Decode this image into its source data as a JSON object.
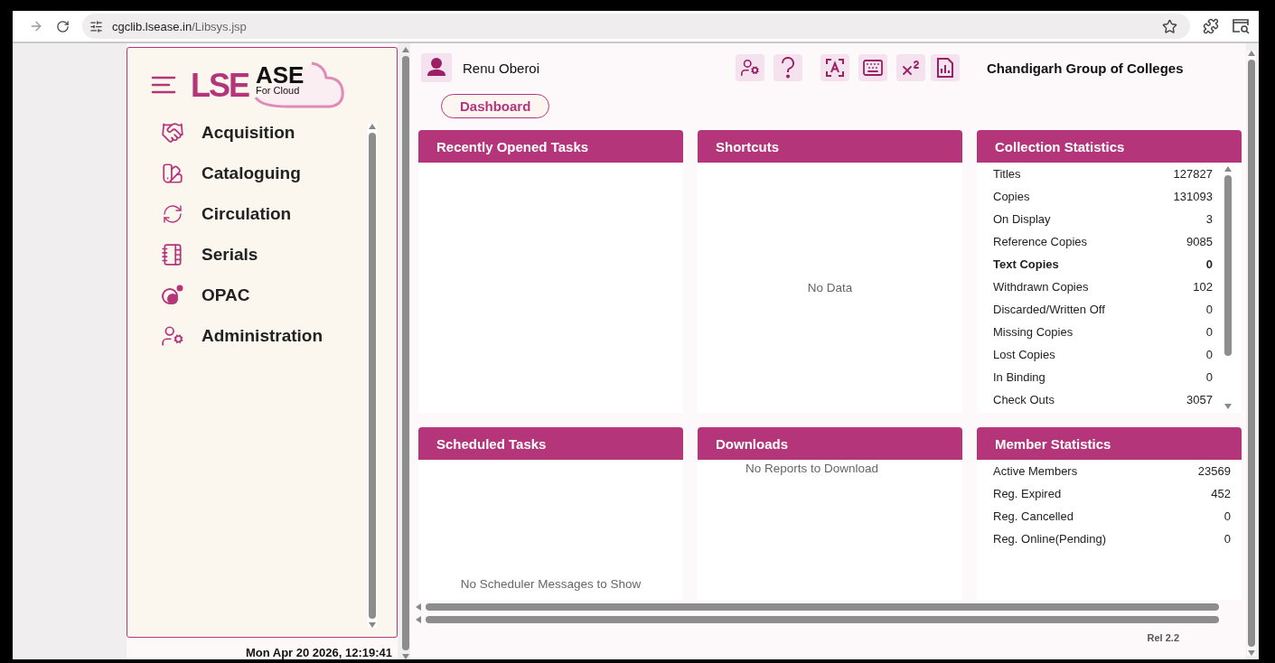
{
  "browser": {
    "url_host": "cgclib.lsease.in",
    "url_path": "/Libsys.jsp"
  },
  "logo": {
    "mark": "LSE",
    "accent": "ASE",
    "tagline": "For Cloud"
  },
  "sidebar": {
    "items": [
      {
        "label": "Acquisition"
      },
      {
        "label": "Cataloguing"
      },
      {
        "label": "Circulation"
      },
      {
        "label": "Serials"
      },
      {
        "label": "OPAC"
      },
      {
        "label": "Administration"
      }
    ],
    "datetime": "Mon Apr 20 2026, 12:19:41"
  },
  "header": {
    "user": "Renu Oberoi",
    "organization": "Chandigarh Group of Colleges"
  },
  "tabs": [
    {
      "label": "Dashboard",
      "selected": true
    }
  ],
  "panels": [
    {
      "title": "Recently Opened Tasks",
      "kind": "empty"
    },
    {
      "title": "Shortcuts",
      "kind": "message",
      "message": "No Data"
    },
    {
      "title": "Collection Statistics",
      "kind": "stats",
      "rows": [
        {
          "label": "Titles",
          "value": "127827",
          "bold": false
        },
        {
          "label": "Copies",
          "value": "131093",
          "bold": false
        },
        {
          "label": "On Display",
          "value": "3",
          "bold": false
        },
        {
          "label": "Reference Copies",
          "value": "9085",
          "bold": false
        },
        {
          "label": "Text Copies",
          "value": "0",
          "bold": true
        },
        {
          "label": "Withdrawn Copies",
          "value": "102",
          "bold": false
        },
        {
          "label": "Discarded/Written Off",
          "value": "0",
          "bold": false
        },
        {
          "label": "Missing Copies",
          "value": "0",
          "bold": false
        },
        {
          "label": "Lost Copies",
          "value": "0",
          "bold": false
        },
        {
          "label": "In Binding",
          "value": "0",
          "bold": false
        },
        {
          "label": "Check Outs",
          "value": "3057",
          "bold": false
        }
      ]
    },
    {
      "title": "Scheduled Tasks",
      "kind": "footnote",
      "message": "No Scheduler Messages to Show"
    },
    {
      "title": "Downloads",
      "kind": "caption",
      "message": "No Reports to Download"
    },
    {
      "title": "Member Statistics",
      "kind": "stats",
      "rows": [
        {
          "label": "Active Members",
          "value": "23569",
          "bold": false
        },
        {
          "label": "Reg. Expired",
          "value": "452",
          "bold": false
        },
        {
          "label": "Reg. Cancelled",
          "value": "0",
          "bold": false
        },
        {
          "label": "Reg. Online(Pending)",
          "value": "0",
          "bold": false
        }
      ]
    }
  ],
  "footer": {
    "release": "Rel 2.2"
  }
}
